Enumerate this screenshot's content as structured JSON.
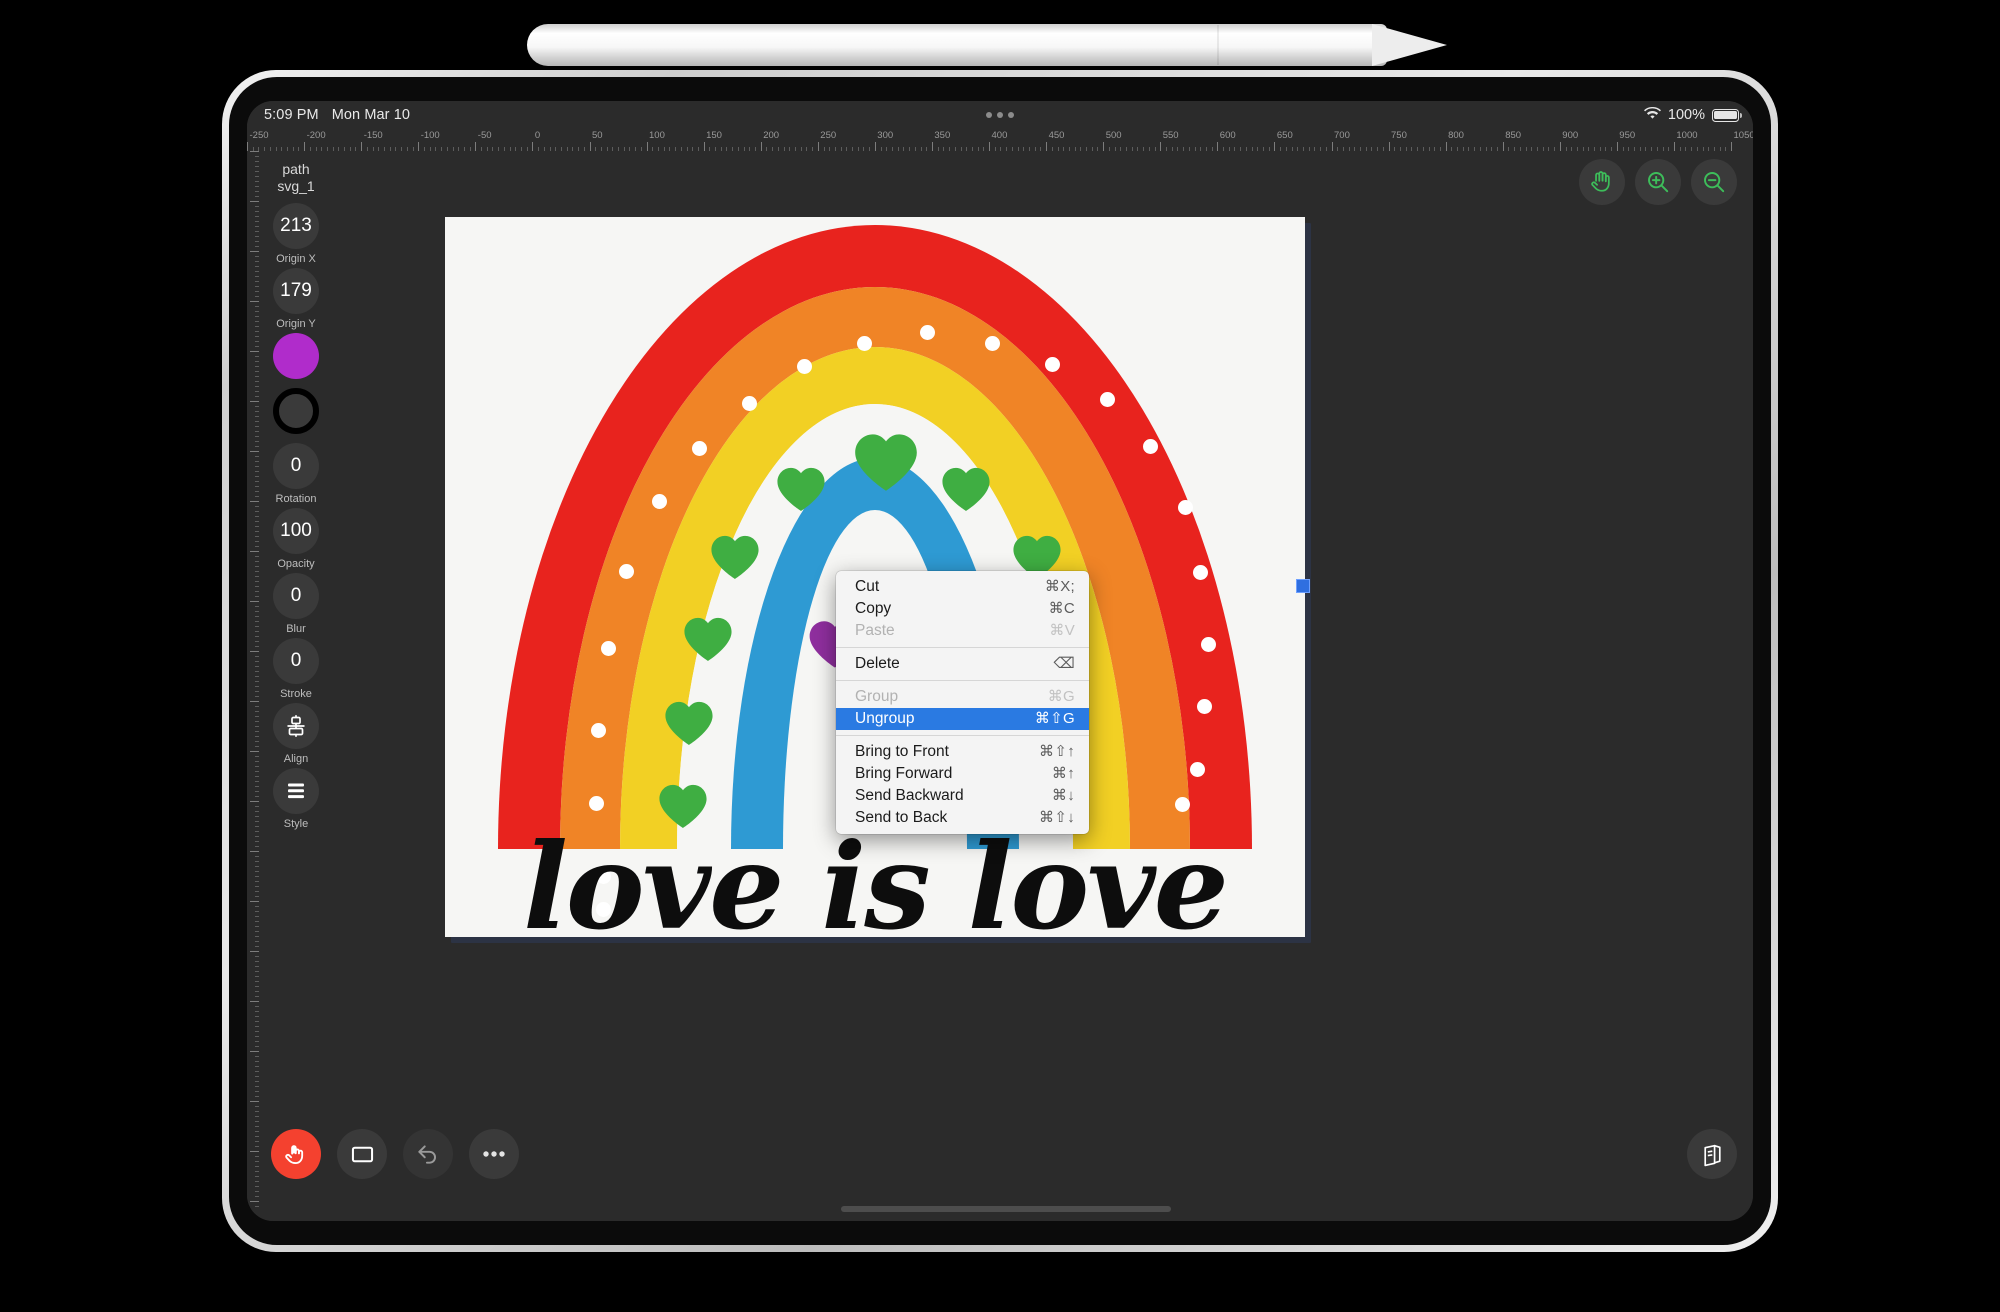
{
  "status_bar": {
    "time": "5:09 PM",
    "date": "Mon Mar 10",
    "battery_percent": "100%",
    "wifi_icon": "wifi-icon",
    "battery_icon": "battery-icon",
    "multitask_handle": "multitasking-dots"
  },
  "ruler": {
    "start": -250,
    "end": 1050,
    "major_step": 50,
    "minor_per_major": 10,
    "labels": [
      "-250",
      "-200",
      "-150",
      "-100",
      "-50",
      "0",
      "50",
      "100",
      "150",
      "200",
      "250",
      "300",
      "350",
      "400",
      "450",
      "500",
      "550",
      "600",
      "650",
      "700",
      "750",
      "800",
      "850",
      "900",
      "950",
      "1000",
      "1050"
    ]
  },
  "sidebar": {
    "layer_type": "path",
    "layer_id": "svg_1",
    "properties": [
      {
        "value": "213",
        "label": "Origin X",
        "name": "origin-x"
      },
      {
        "value": "179",
        "label": "Origin Y",
        "name": "origin-y"
      },
      {
        "value": "",
        "label": "",
        "name": "fill-color",
        "color": "#b02ccb"
      },
      {
        "value": "",
        "label": "",
        "name": "stroke-color",
        "color": "#000000"
      },
      {
        "value": "0",
        "label": "Rotation",
        "name": "rotation"
      },
      {
        "value": "100",
        "label": "Opacity",
        "name": "opacity"
      },
      {
        "value": "0",
        "label": "Blur",
        "name": "blur"
      },
      {
        "value": "0",
        "label": "Stroke",
        "name": "stroke-width"
      }
    ],
    "align_label": "Align",
    "style_label": "Style"
  },
  "toolbar_top": {
    "pan_tool": "hand-icon",
    "zoom_in": "zoom-in-icon",
    "zoom_out": "zoom-out-icon",
    "accent_color": "#3dbd5a"
  },
  "toolbar_bottom": {
    "select_tool": "pointer-hand-icon",
    "rect_tool": "rectangle-icon",
    "undo": "undo-icon",
    "more": "more-dots-icon",
    "layers": "layers-panel-icon",
    "primary_color": "#f4412f"
  },
  "context_menu": {
    "groups": [
      [
        {
          "label": "Cut",
          "shortcut": "⌘X;",
          "state": "normal"
        },
        {
          "label": "Copy",
          "shortcut": "⌘C",
          "state": "normal"
        },
        {
          "label": "Paste",
          "shortcut": "⌘V",
          "state": "disabled"
        }
      ],
      [
        {
          "label": "Delete",
          "shortcut": "⌫",
          "state": "normal"
        }
      ],
      [
        {
          "label": "Group",
          "shortcut": "⌘G",
          "state": "disabled"
        },
        {
          "label": "Ungroup",
          "shortcut": "⌘⇧G",
          "state": "selected"
        }
      ],
      [
        {
          "label": "Bring to Front",
          "shortcut": "⌘⇧↑",
          "state": "normal"
        },
        {
          "label": "Bring Forward",
          "shortcut": "⌘↑",
          "state": "normal"
        },
        {
          "label": "Send Backward",
          "shortcut": "⌘↓",
          "state": "normal"
        },
        {
          "label": "Send to Back",
          "shortcut": "⌘⇧↓",
          "state": "normal"
        }
      ]
    ],
    "highlight_color": "#2a7ae2"
  },
  "artwork": {
    "title": "love is love",
    "background": "#f6f6f4",
    "bands": [
      {
        "name": "red",
        "color": "#e8231e"
      },
      {
        "name": "orange",
        "color": "#f08426"
      },
      {
        "name": "yellow",
        "color": "#f2d024"
      },
      {
        "name": "white",
        "color": "#f6f6f4"
      },
      {
        "name": "blue",
        "color": "#2e9ad3"
      }
    ],
    "heart_color": "#3fae42",
    "accent_heart_color": "#8f2f9e",
    "dot_color": "#ffffff"
  }
}
